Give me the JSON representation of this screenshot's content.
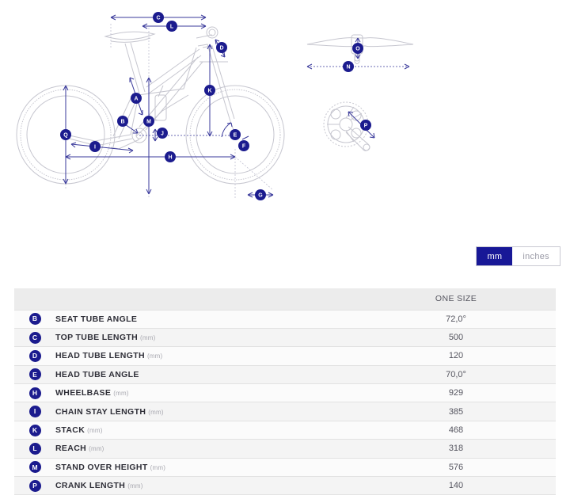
{
  "unit_toggle": {
    "name": "unit-toggle",
    "options": [
      {
        "label": "mm",
        "active": true
      },
      {
        "label": "inches",
        "active": false
      }
    ]
  },
  "table": {
    "headers": {
      "badge": "",
      "label": "",
      "size": "ONE SIZE"
    },
    "rows": [
      {
        "badge": "B",
        "label": "SEAT TUBE ANGLE",
        "unit": "",
        "value": "72,0°"
      },
      {
        "badge": "C",
        "label": "TOP TUBE LENGTH",
        "unit": "(mm)",
        "value": "500"
      },
      {
        "badge": "D",
        "label": "HEAD TUBE LENGTH",
        "unit": "(mm)",
        "value": "120"
      },
      {
        "badge": "E",
        "label": "HEAD TUBE ANGLE",
        "unit": "",
        "value": "70,0°"
      },
      {
        "badge": "H",
        "label": "WHEELBASE",
        "unit": "(mm)",
        "value": "929"
      },
      {
        "badge": "I",
        "label": "CHAIN STAY LENGTH",
        "unit": "(mm)",
        "value": "385"
      },
      {
        "badge": "K",
        "label": "STACK",
        "unit": "(mm)",
        "value": "468"
      },
      {
        "badge": "L",
        "label": "REACH",
        "unit": "(mm)",
        "value": "318"
      },
      {
        "badge": "M",
        "label": "STAND OVER HEIGHT",
        "unit": "(mm)",
        "value": "576"
      },
      {
        "badge": "P",
        "label": "CRANK LENGTH",
        "unit": "(mm)",
        "value": "140"
      }
    ]
  },
  "diagram": {
    "side_view_markers": [
      "C",
      "L",
      "D",
      "A",
      "K",
      "B",
      "M",
      "J",
      "E",
      "F",
      "Q",
      "I",
      "H",
      "G"
    ],
    "handlebar_markers": [
      "O",
      "N"
    ],
    "crankset_markers": [
      "P"
    ]
  },
  "colors": {
    "accent": "#1b1b8e",
    "dimension_line": "#3a3a9b",
    "bike_outline": "#c6c6cf",
    "header_bg": "#ececec",
    "row_odd": "#fbfbfb",
    "row_even": "#f4f4f4"
  }
}
